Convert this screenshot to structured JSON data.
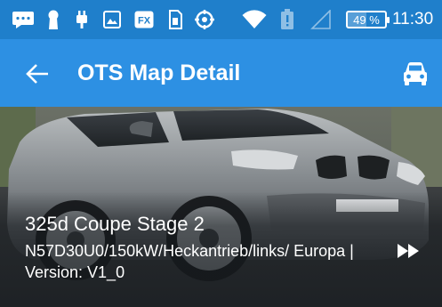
{
  "status_bar": {
    "icons": [
      "message-icon",
      "keyhole-icon",
      "usb-icon",
      "image-icon",
      "fx-app-icon",
      "sim-icon",
      "sync-icon",
      "wifi-icon",
      "battery-alert-icon",
      "no-signal-icon"
    ],
    "fx_label": "FX",
    "battery_percent": "49 %",
    "battery_level": 0.49,
    "time": "11:30"
  },
  "app_bar": {
    "title": "OTS Map Detail",
    "back_icon": "arrow-back-icon",
    "action_icon": "car-icon"
  },
  "vehicle": {
    "name": "325d Coupe Stage 2",
    "detail": "N57D30U0/150kW/Heckantrieb/links/ Europa | Version: V1_0",
    "action_icon": "fast-forward-icon"
  },
  "colors": {
    "status_bar": "#1f7fcb",
    "app_bar": "#2d90e3",
    "text_light": "#ffffff"
  }
}
